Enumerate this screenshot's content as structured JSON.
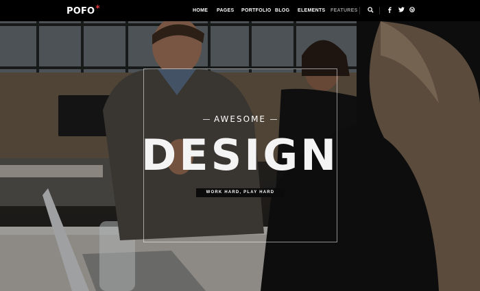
{
  "header": {
    "logo": "POFO",
    "logo_mark": "*",
    "nav": [
      {
        "label": "HOME"
      },
      {
        "label": "PAGES"
      },
      {
        "label": "PORTFOLIO"
      },
      {
        "label": "BLOG"
      },
      {
        "label": "ELEMENTS"
      },
      {
        "label": "FEATURES"
      }
    ],
    "icons": {
      "search": "search-icon",
      "facebook": "facebook-icon",
      "twitter": "twitter-icon",
      "dribbble": "dribbble-icon"
    }
  },
  "hero": {
    "kicker": "AWESOME",
    "headline": "DESIGN",
    "tagline": "WORK HARD, PLAY HARD"
  },
  "colors": {
    "brand": "#ffffff",
    "logo_accent": "#e53a3a",
    "nav_muted": "#9a9a9a"
  }
}
